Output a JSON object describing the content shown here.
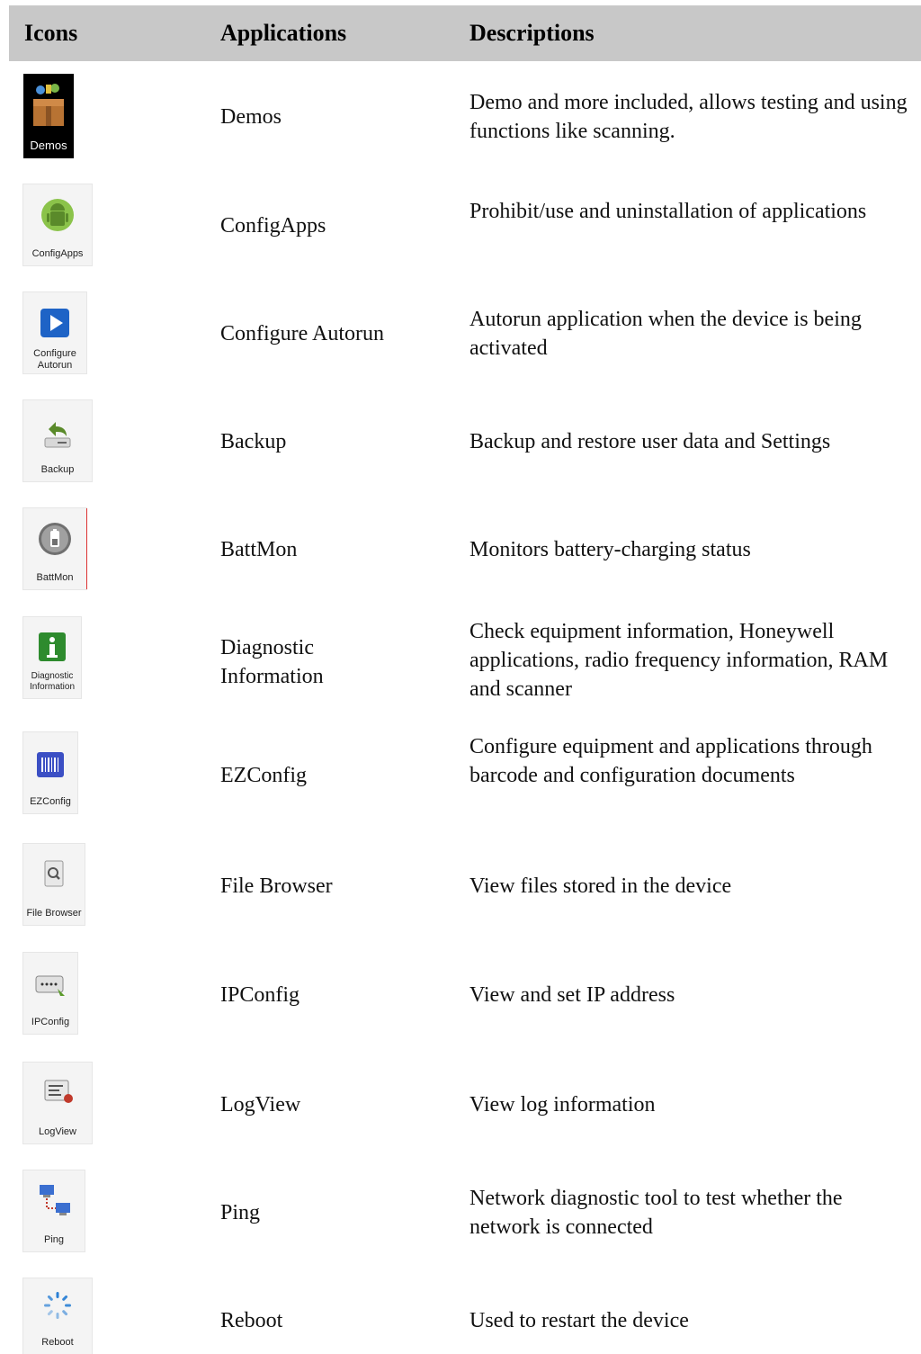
{
  "header": {
    "icons": "Icons",
    "applications": "Applications",
    "descriptions": "Descriptions"
  },
  "rows": [
    {
      "icon_name": "demos-box-icon",
      "icon_label": "Demos",
      "app": "Demos",
      "desc": "Demo and more included, allows testing and using functions like scanning."
    },
    {
      "icon_name": "android-config-icon",
      "icon_label": "ConfigApps",
      "app": "ConfigApps",
      "desc": "Prohibit/use and uninstallation of applications"
    },
    {
      "icon_name": "play-autorun-icon",
      "icon_label": "Configure Autorun",
      "app": "Configure Autorun",
      "desc": "Autorun application when the device is being activated"
    },
    {
      "icon_name": "backup-arrow-icon",
      "icon_label": "Backup",
      "app": "Backup",
      "desc": "Backup and restore user data and Settings"
    },
    {
      "icon_name": "battery-monitor-icon",
      "icon_label": "BattMon",
      "app": "BattMon",
      "desc": "Monitors battery-charging status"
    },
    {
      "icon_name": "info-icon",
      "icon_label": "Diagnostic Information",
      "app": "Diagnostic Information",
      "desc": "Check equipment information, Honeywell applications, radio frequency information, RAM and scanner"
    },
    {
      "icon_name": "barcode-icon",
      "icon_label": "EZConfig",
      "app": "EZConfig",
      "desc": "Configure equipment and applications through barcode and configuration documents"
    },
    {
      "icon_name": "file-search-icon",
      "icon_label": "File Browser",
      "app": "File Browser",
      "desc": "View files stored in the device"
    },
    {
      "icon_name": "ip-config-icon",
      "icon_label": "IPConfig",
      "app": "IPConfig",
      "desc": "View and set IP address"
    },
    {
      "icon_name": "log-view-icon",
      "icon_label": "LogView",
      "app": "LogView",
      "desc": "View log information"
    },
    {
      "icon_name": "ping-network-icon",
      "icon_label": "Ping",
      "app": "Ping",
      "desc": "Network diagnostic tool to test whether the network is connected"
    },
    {
      "icon_name": "reboot-spinner-icon",
      "icon_label": "Reboot",
      "app": "Reboot",
      "desc": "Used to restart the device"
    }
  ]
}
